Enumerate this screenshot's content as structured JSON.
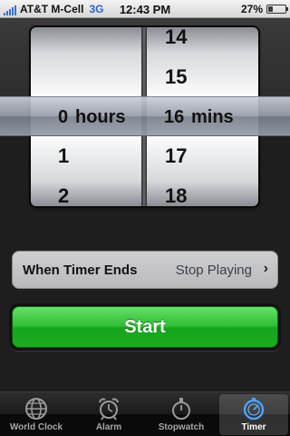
{
  "status_bar": {
    "carrier": "AT&T M-Cell",
    "network": "3G",
    "time": "12:43 PM",
    "battery_percent": "27%",
    "battery_level": 0.27,
    "signal_bars": 5
  },
  "picker": {
    "hours_wheel": {
      "above": [],
      "selected": "0",
      "below": [
        "1",
        "2"
      ],
      "unit": "hours"
    },
    "minutes_wheel": {
      "above": [
        "14",
        "15"
      ],
      "selected": "16",
      "below": [
        "17",
        "18"
      ],
      "unit": "mins"
    }
  },
  "timer_ends": {
    "label": "When Timer Ends",
    "value": "Stop Playing",
    "chevron": "›"
  },
  "start_button": {
    "label": "Start"
  },
  "tab_bar": {
    "active": "Timer",
    "tabs": [
      {
        "label": "World Clock",
        "icon": "globe-icon"
      },
      {
        "label": "Alarm",
        "icon": "alarm-clock-icon"
      },
      {
        "label": "Stopwatch",
        "icon": "stopwatch-icon"
      },
      {
        "label": "Timer",
        "icon": "timer-icon"
      }
    ]
  },
  "colors": {
    "start_green": "#2fbd34",
    "active_tab_icon": "#4aa3ff"
  }
}
